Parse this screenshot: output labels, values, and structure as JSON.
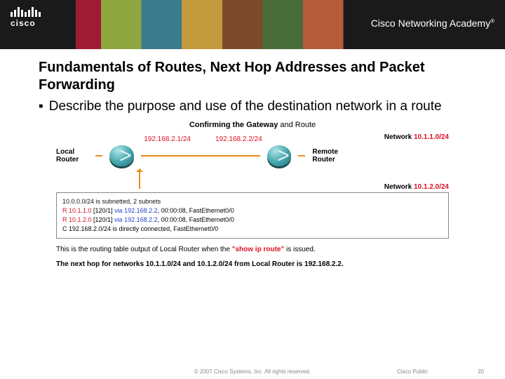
{
  "brand": {
    "name": "cisco",
    "academy": "Cisco Networking Academy",
    "tm": "®"
  },
  "title": "Fundamentals of Routes, Next Hop Addresses and Packet Forwarding",
  "bullet_mark": "▪",
  "bullet": "Describe the purpose and use of the destination network in a route",
  "diagram": {
    "title_a": "Confirming the Gateway",
    "title_b": " and Route",
    "net1_label": "Network ",
    "net1_ip": "10.1.1.0/24",
    "net2_label": "Network ",
    "net2_ip": "10.1.2.0/24",
    "ip_left": "192.168.2.1/24",
    "ip_right": "192.168.2.2/24",
    "local": "Local Router",
    "remote": "Remote Router"
  },
  "rtable": {
    "l1": "10.0.0.0/24 is subnetted, 2 subnets",
    "l2a": "R 10.1.1.0",
    "l2b": " [120/1] ",
    "l2c": "via 192.168.2.2",
    "l2d": ", 00:00:08, FastEthernet0/0",
    "l3a": "R 10.1.2.0",
    "l3b": " [120/1] ",
    "l3c": "via 192.168.2.2",
    "l3d": ", 00:00:08, FastEthernet0/0",
    "l4": "C 192.168.2.0/24 is directly connected, FastEthernet0/0"
  },
  "caption1a": "This is the routing table output of Local Router when the ",
  "caption1b": "\"show ip route\"",
  "caption1c": " is issued.",
  "caption2": "The next hop for networks 10.1.1.0/24 and 10.1.2.0/24 from Local Router is 192.168.2.2.",
  "footer": {
    "copyright": "© 2007 Cisco Systems, Inc. All rights reserved.",
    "label": "Cisco Public",
    "page": "20"
  }
}
